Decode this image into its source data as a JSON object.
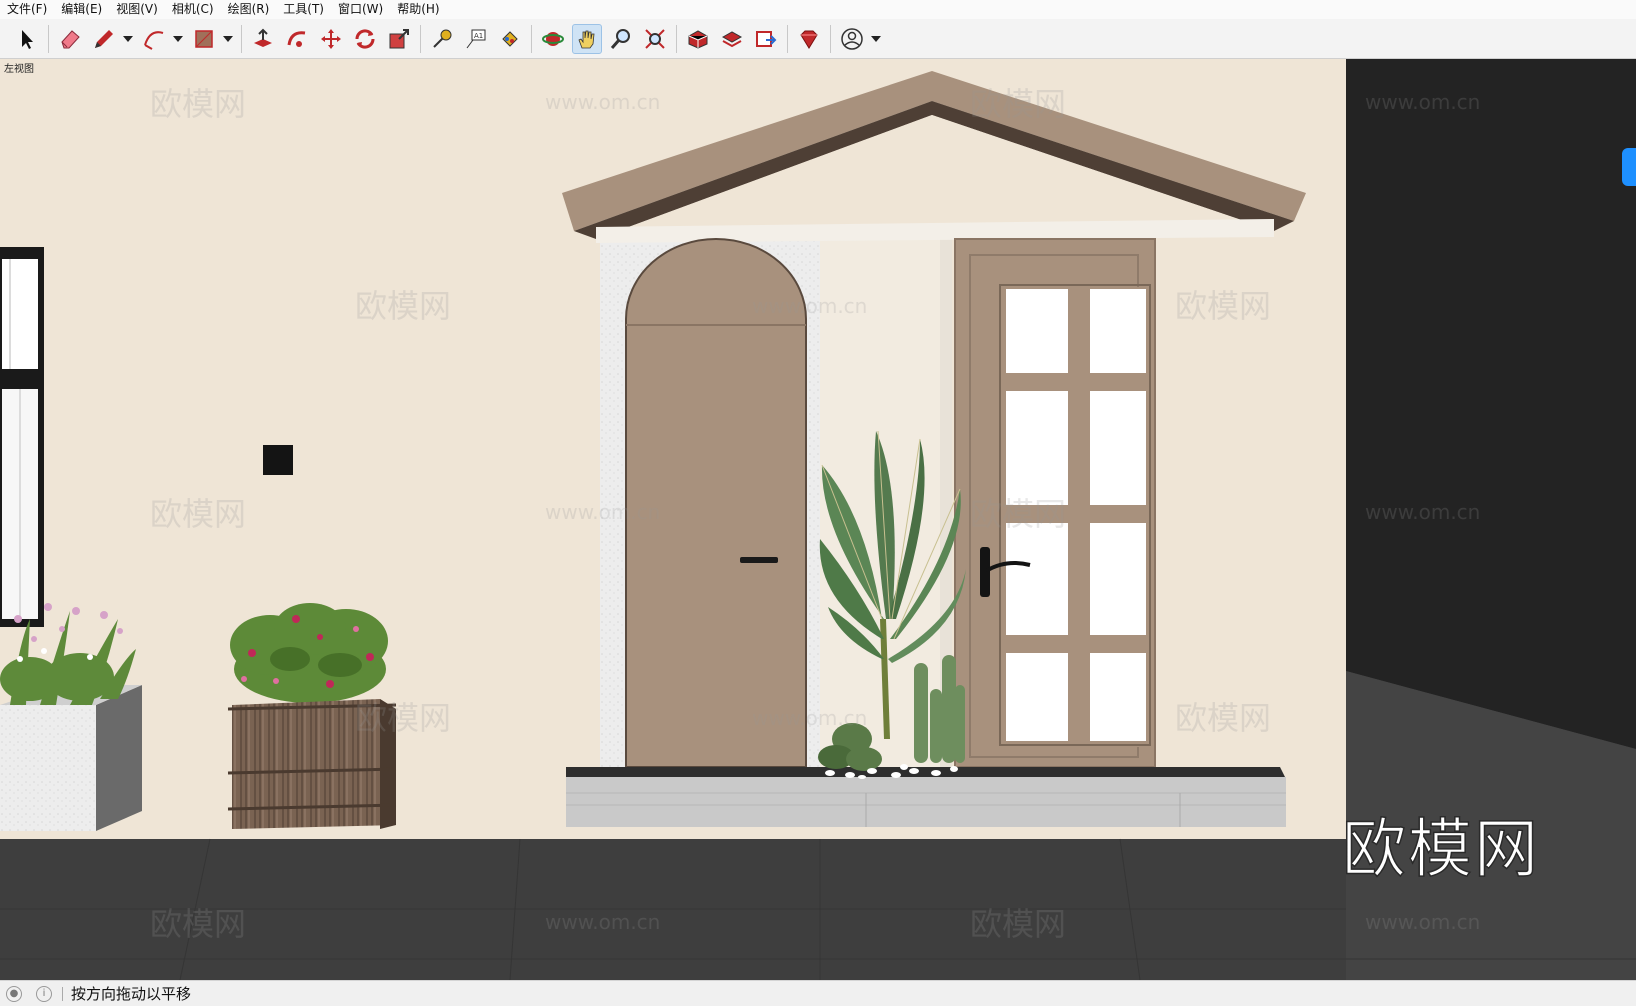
{
  "menu": [
    "文件(F)",
    "编辑(E)",
    "视图(V)",
    "相机(C)",
    "绘图(R)",
    "工具(T)",
    "窗口(W)",
    "帮助(H)"
  ],
  "toolbar": {
    "tools": [
      "select-tool",
      "eraser-tool",
      "pencil-tool",
      "arc-tool",
      "shape-tool",
      "push-pull-tool",
      "follow-me-tool",
      "move-tool",
      "rotate-tool",
      "scale-tool",
      "tape-measure-tool",
      "text-tool",
      "paint-bucket-tool",
      "orbit-tool",
      "pan-tool",
      "zoom-tool",
      "zoom-extents-tool",
      "warehouse-tool",
      "extension-warehouse-tool",
      "send-to-layout-tool",
      "ruby-tool",
      "account-tool"
    ],
    "active_tool": "pan-tool"
  },
  "viewport": {
    "view_name": "左视图",
    "watermark_logo": "欧模网",
    "watermark_url": "www.om.cn",
    "brand_mark": "欧模网"
  },
  "status": {
    "message": "按方向拖动以平移"
  },
  "colors": {
    "wall": "#efe5d6",
    "roof": "#a8917d",
    "door": "#a8917d",
    "floor": "#3e3e3e",
    "dark_wall": "#232323",
    "accent": "#1e90ff"
  }
}
